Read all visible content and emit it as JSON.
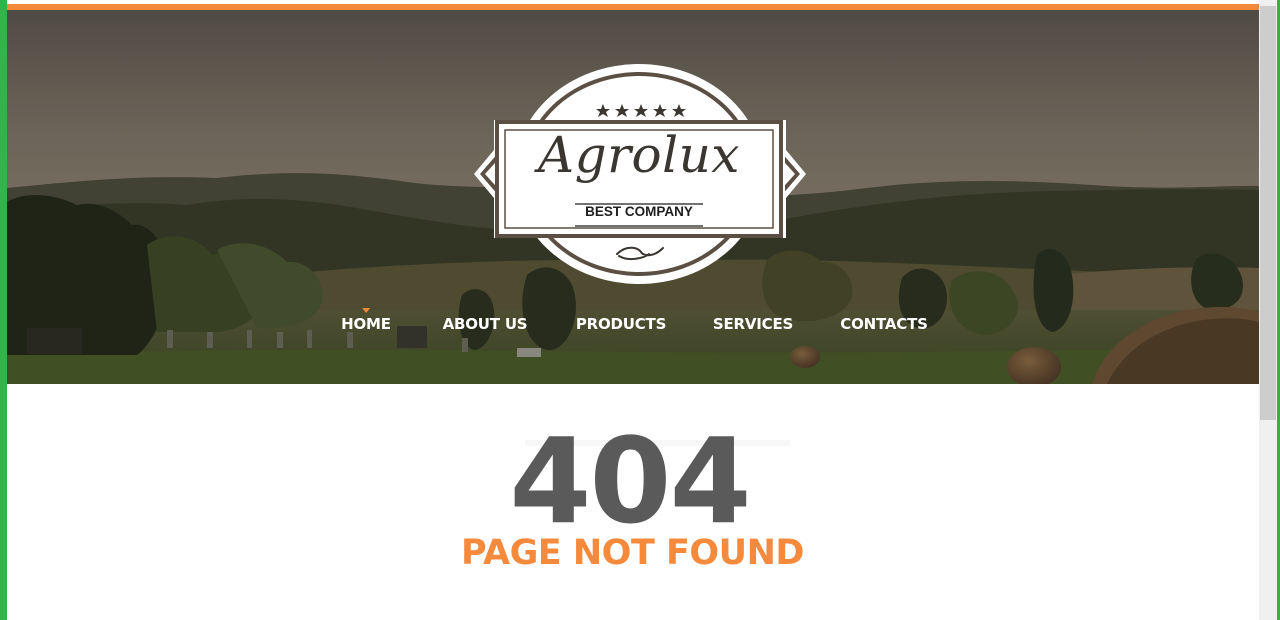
{
  "site": {
    "logo_title": "Agrolux",
    "logo_tagline": "BEST COMPANY"
  },
  "nav": {
    "items": [
      {
        "label": "HOME",
        "active": true
      },
      {
        "label": "ABOUT US",
        "active": false
      },
      {
        "label": "PRODUCTS",
        "active": false
      },
      {
        "label": "SERVICES",
        "active": false
      },
      {
        "label": "CONTACTS",
        "active": false
      }
    ]
  },
  "error": {
    "code": "404",
    "message": "PAGE NOT FOUND"
  },
  "colors": {
    "accent": "#f58a3c",
    "error_code": "#5a5a5a",
    "window_border": "#2fb54a"
  }
}
